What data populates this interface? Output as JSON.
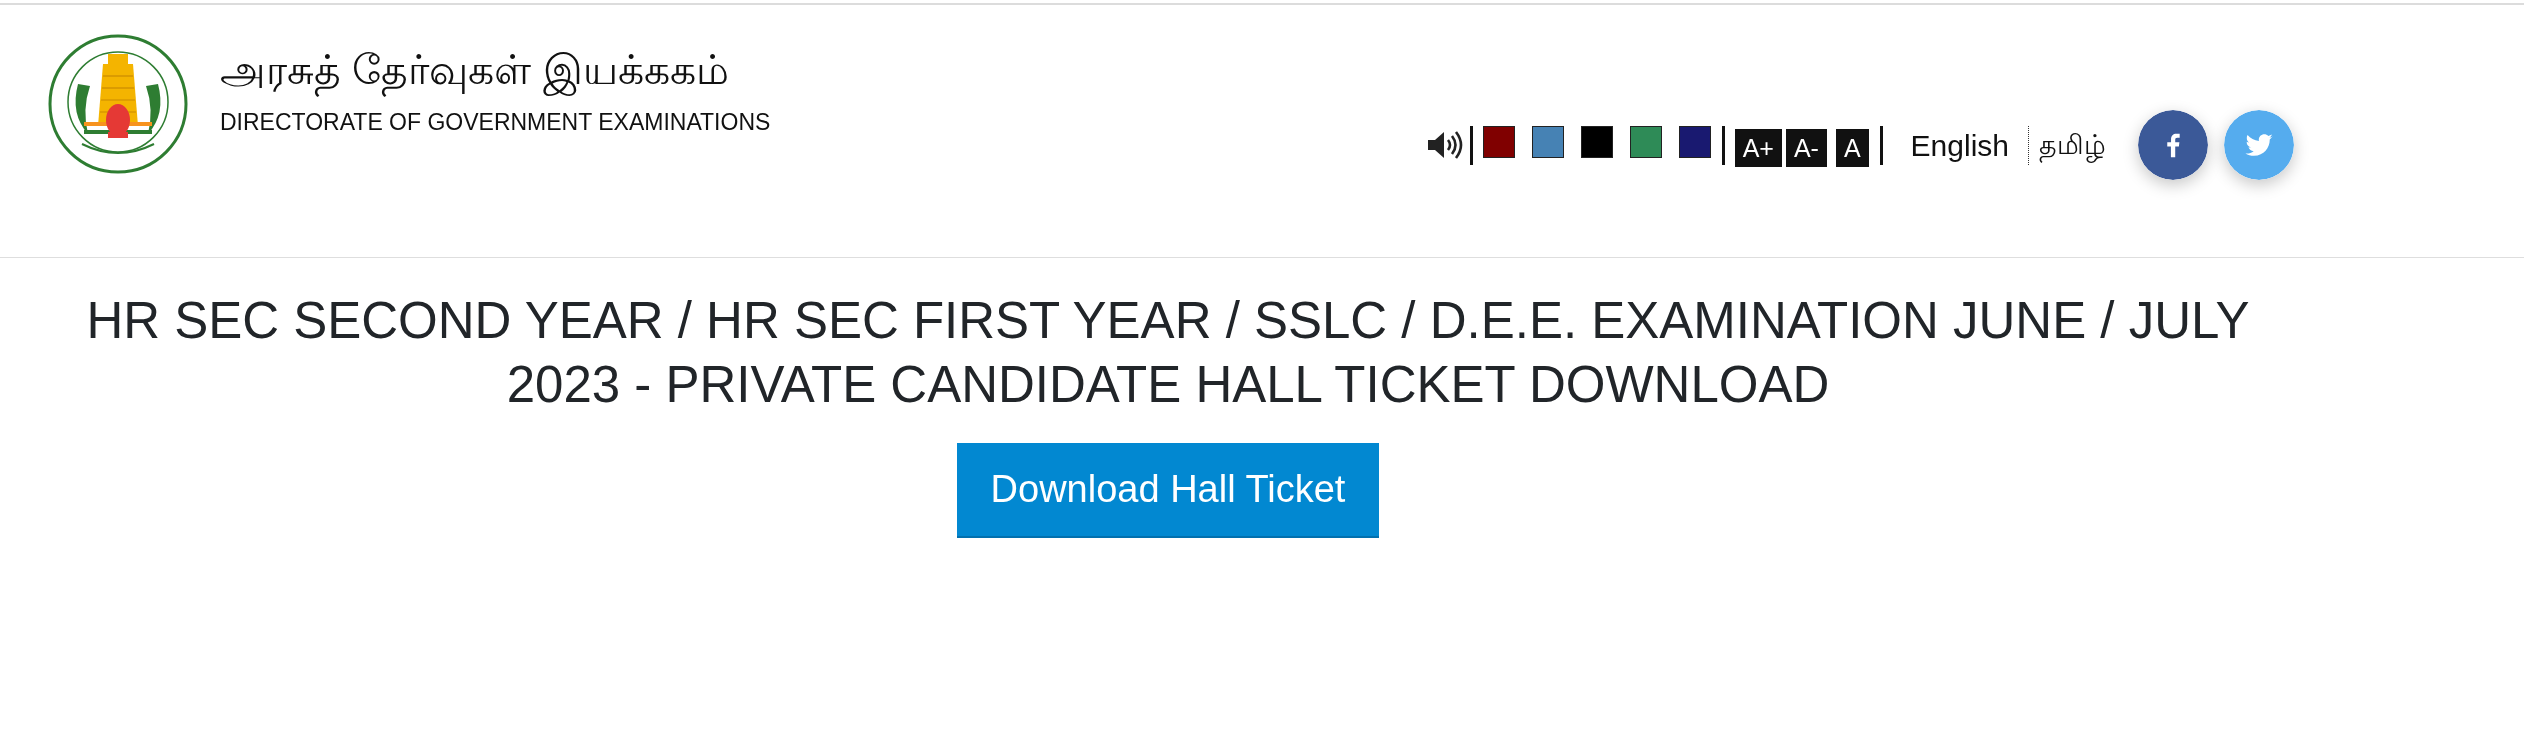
{
  "header": {
    "title_tamil": "அரசுத் தேர்வுகள் இயக்ககம்",
    "title_english": "DIRECTORATE OF GOVERNMENT EXAMINATIONS"
  },
  "toolbar": {
    "color_themes": [
      {
        "color": "#800000"
      },
      {
        "color": "#4682b4"
      },
      {
        "color": "#000000"
      },
      {
        "color": "#2e8b57"
      },
      {
        "color": "#191970"
      }
    ],
    "font_sizes": [
      "A+",
      "A-",
      "A"
    ],
    "languages": [
      "English",
      "தமிழ்"
    ],
    "social": [
      {
        "kind": "facebook"
      },
      {
        "kind": "twitter"
      }
    ]
  },
  "heading": "HR SEC SECOND YEAR / HR SEC FIRST YEAR / SSLC / D.E.E. EXAMINATION JUNE / JULY 2023 - PRIVATE CANDIDATE HALL TICKET DOWNLOAD",
  "download_button": "Download Hall Ticket"
}
